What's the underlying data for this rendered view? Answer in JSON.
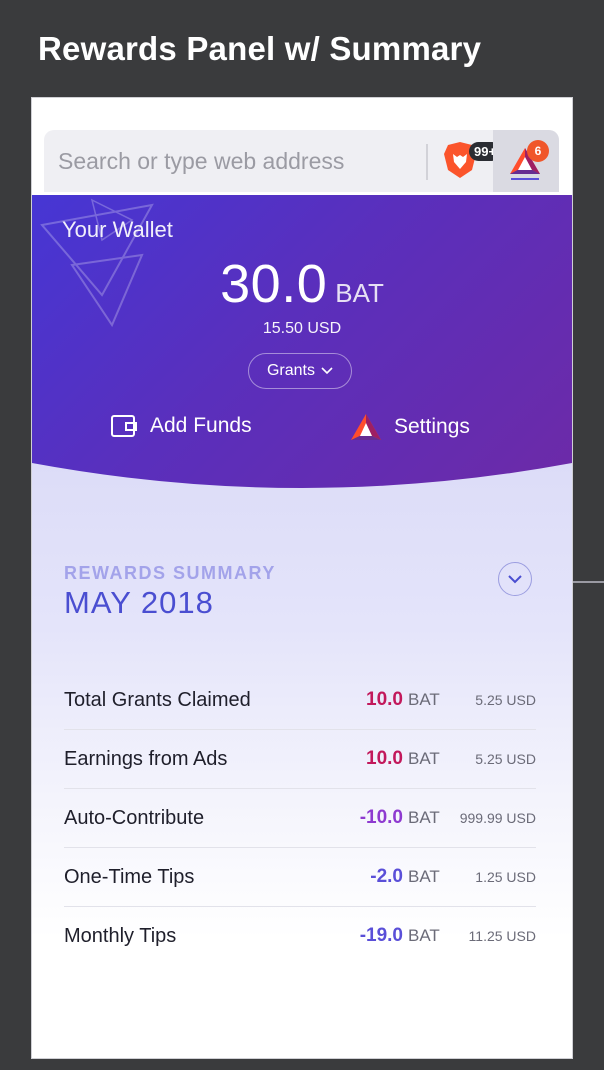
{
  "page": {
    "title": "Rewards Panel w/ Summary"
  },
  "address_bar": {
    "placeholder": "Search or type web address",
    "brave_badge": "99+",
    "rewards_badge": "6"
  },
  "wallet": {
    "label": "Your Wallet",
    "balance": "30.0",
    "unit": "BAT",
    "usd": "15.50 USD",
    "grants_label": "Grants",
    "add_funds_label": "Add Funds",
    "settings_label": "Settings"
  },
  "summary": {
    "label": "REWARDS SUMMARY",
    "month": "MAY 2018",
    "rows": [
      {
        "label": "Total Grants Claimed",
        "amount": "10.0",
        "unit": "BAT",
        "usd": "5.25 USD",
        "color": "#c2185b"
      },
      {
        "label": "Earnings from Ads",
        "amount": "10.0",
        "unit": "BAT",
        "usd": "5.25 USD",
        "color": "#c2185b"
      },
      {
        "label": "Auto-Contribute",
        "amount": "-10.0",
        "unit": "BAT",
        "usd": "999.99 USD",
        "color": "#8e3ad0"
      },
      {
        "label": "One-Time Tips",
        "amount": "-2.0",
        "unit": "BAT",
        "usd": "1.25 USD",
        "color": "#5a4fd8"
      },
      {
        "label": "Monthly Tips",
        "amount": "-19.0",
        "unit": "BAT",
        "usd": "11.25 USD",
        "color": "#5a4fd8"
      }
    ]
  },
  "colors": {
    "background": "#3a3b3d",
    "wallet_gradient_start": "#4636d4",
    "wallet_gradient_end": "#6d2aa7",
    "month": "#4a4ed1",
    "positive": "#c2185b",
    "negative": "#5a4fd8"
  },
  "icons": [
    "brave-lion-icon",
    "bat-rewards-icon",
    "wallet-icon",
    "settings-bat-icon",
    "chevron-down-icon"
  ]
}
